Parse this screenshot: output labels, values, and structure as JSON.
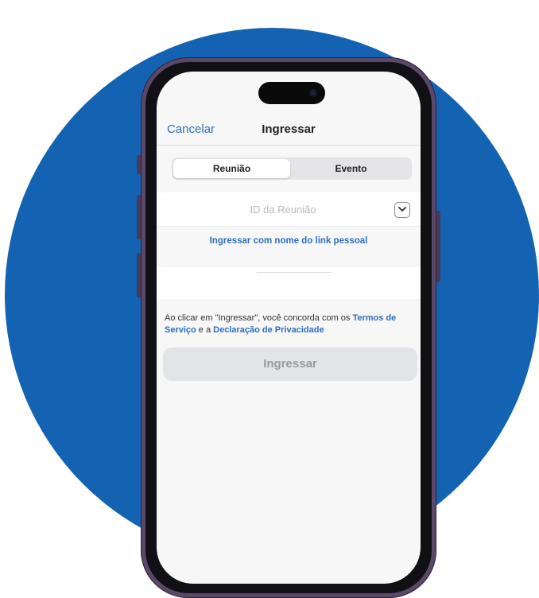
{
  "navbar": {
    "cancel_label": "Cancelar",
    "title": "Ingressar"
  },
  "segmented": {
    "options": [
      {
        "label": "Reunião",
        "selected": true
      },
      {
        "label": "Evento",
        "selected": false
      }
    ]
  },
  "meeting_id": {
    "placeholder": "ID da Reunião",
    "value": "",
    "dropdown_icon": "chevron-down-icon"
  },
  "personal_link_label": "Ingressar com nome do link pessoal",
  "name_field": {
    "value": ""
  },
  "terms": {
    "prefix": "Ao clicar em \"Ingressar\", você concorda com os ",
    "terms_link": "Termos de Serviço",
    "middle": " e a ",
    "privacy_link": "Declaração de Privacidade"
  },
  "join_button_label": "Ingressar",
  "colors": {
    "background_circle": "#1463b2",
    "link": "#2d6fbf",
    "disabled_button": "#e3e4e8"
  }
}
